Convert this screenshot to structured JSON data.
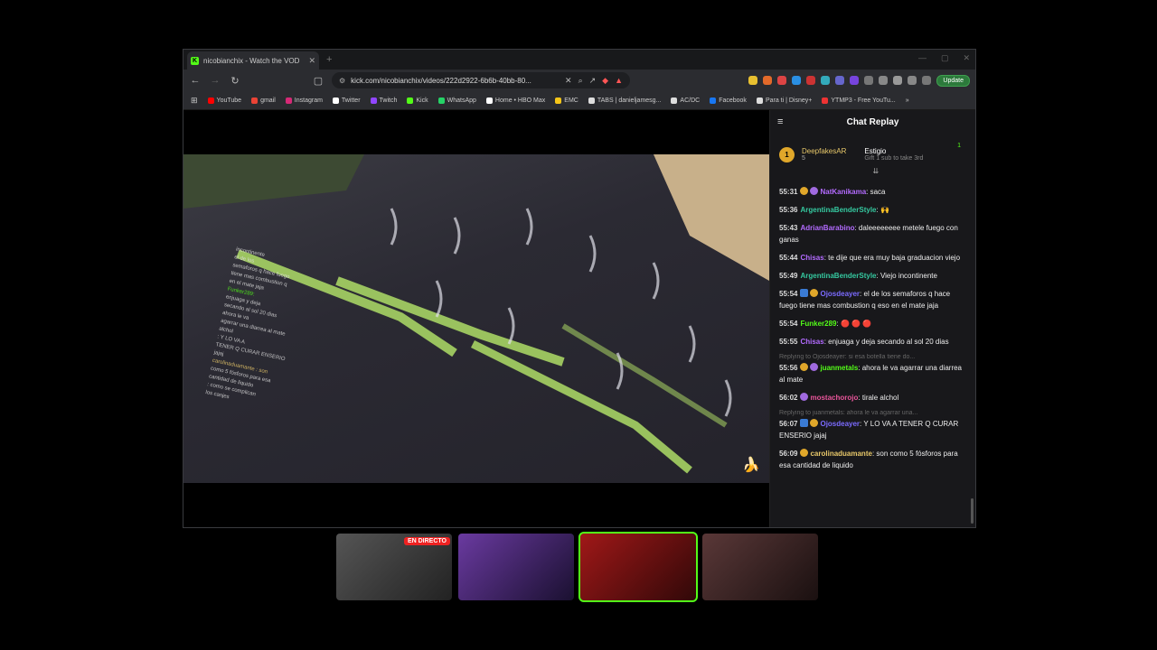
{
  "browser": {
    "tab_title": "nicobianchix - Watch the VOD",
    "tab_close": "✕",
    "new_tab": "+",
    "url": "kick.com/nicobianchix/videos/222d2922-6b6b-40bb-80...",
    "update_label": "Update",
    "window_controls": [
      "—",
      "▢",
      "✕"
    ]
  },
  "bookmarks": [
    {
      "label": "YouTube",
      "color": "#ff0000"
    },
    {
      "label": "gmail",
      "color": "#ea4335"
    },
    {
      "label": "Instagram",
      "color": "#d62976"
    },
    {
      "label": "Twitter",
      "color": "#ffffff"
    },
    {
      "label": "Twitch",
      "color": "#9146ff"
    },
    {
      "label": "Kick",
      "color": "#53fc18"
    },
    {
      "label": "WhatsApp",
      "color": "#25d366"
    },
    {
      "label": "Home • HBO Max",
      "color": "#ffffff"
    },
    {
      "label": "EMC",
      "color": "#f5c518"
    },
    {
      "label": "TABS | danieljamesg...",
      "color": "#dddddd"
    },
    {
      "label": "AC/DC",
      "color": "#dddddd"
    },
    {
      "label": "Facebook",
      "color": "#1877f2"
    },
    {
      "label": "Para ti | Disney+",
      "color": "#113ccf"
    },
    {
      "label": "YTMP3 - Free YouTu...",
      "color": "#e33"
    }
  ],
  "bookmarks_more": "»",
  "chat": {
    "title": "Chat Replay",
    "leaderboard": [
      {
        "rank": "1",
        "name": "DeepfakesAR",
        "count": "5"
      },
      {
        "name": "Estigio",
        "note": "Gift 1 sub to take 3rd",
        "count": "1"
      }
    ],
    "messages": [
      {
        "time": "55:31",
        "user": "NatKanikama",
        "color": "#b36bff",
        "text": ": saca",
        "reply": ""
      },
      {
        "time": "55:36",
        "user": "ArgentinaBenderStyle",
        "color": "#35c9a0",
        "text": ": 🙌",
        "reply": ""
      },
      {
        "time": "55:43",
        "user": "AdrianBarabino",
        "color": "#b36bff",
        "text": ": daleeeeeeee metele fuego con ganas",
        "reply": ""
      },
      {
        "time": "55:44",
        "user": "Chisas",
        "color": "#b36bff",
        "text": ": te dije que era muy baja graduacion viejo",
        "reply": ""
      },
      {
        "time": "55:49",
        "user": "ArgentinaBenderStyle",
        "color": "#35c9a0",
        "text": ": Viejo incontinente",
        "reply": ""
      },
      {
        "time": "55:54",
        "user": "Ojosdeayer",
        "color": "#7b6bff",
        "text": ": el de los semaforos q hace fuego tiene mas combustion q eso en el mate jaja",
        "reply": ""
      },
      {
        "time": "55:54",
        "user": "Funker289",
        "color": "#53fc18",
        "text": ": 🔴 🔴 🔴",
        "reply": ""
      },
      {
        "time": "55:55",
        "user": "Chisas",
        "color": "#b36bff",
        "text": ": enjuaga y deja secando al sol 20 dias",
        "reply": ""
      },
      {
        "time": "55:56",
        "user": "juanmetals",
        "color": "#53fc18",
        "text": ": ahora le va agarrar una diarrea al mate",
        "reply": "Replying to Ojosdeayer: si esa botella tiene do..."
      },
      {
        "time": "56:02",
        "user": "mostachorojo",
        "color": "#e8559a",
        "text": ": tirale alchol",
        "reply": ""
      },
      {
        "time": "56:07",
        "user": "Ojosdeayer",
        "color": "#7b6bff",
        "text": ": Y LO VA A TENER Q CURAR ENSERIO jajaj",
        "reply": "Replying to juanmetals: ahora le va agarrar una..."
      },
      {
        "time": "56:09",
        "user": "carolinaduamante",
        "color": "#e8c86a",
        "text": ": son como 5 fósforos para esa cantidad de liquido",
        "reply": ""
      }
    ]
  },
  "video": {
    "overlay_lines": [
      "incontinente",
      "el de los",
      "semaforos q hace fuego",
      "tiene mas combustion q",
      "en el mate jaja",
      "Funker289:",
      "enjuaga y deja",
      "secando al sol 20 dias",
      "ahora le va",
      "agarrar una diarrea al mate",
      "alchol",
      ": Y LO VA A",
      "TENER Q CURAR ENSERIO",
      "jajaj",
      "carolinaduamante : son",
      "como 5 fósforos para esa",
      "cantidad de liquido",
      ": como se complican",
      "los canjes"
    ]
  },
  "thumbnails": [
    {
      "live_label": "EN DIRECTO",
      "bg": "#3a3a3a"
    },
    {
      "live_label": "",
      "bg": "#4a2a6a"
    },
    {
      "live_label": "",
      "bg": "#6a1010"
    },
    {
      "live_label": "",
      "bg": "#3a2828"
    }
  ]
}
